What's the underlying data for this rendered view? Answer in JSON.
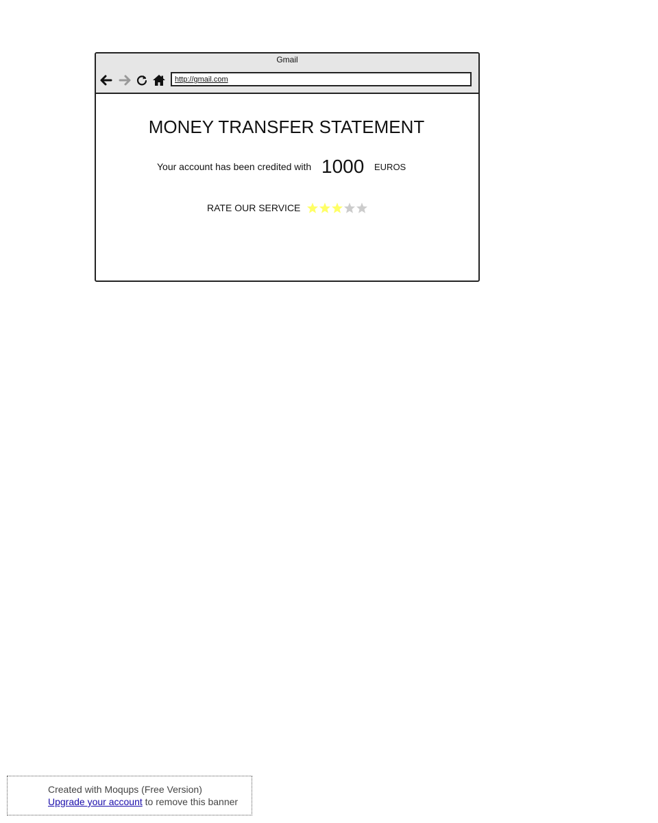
{
  "browser": {
    "window_title": "Gmail",
    "address": "http://gmail.com",
    "nav_icons": [
      "back-arrow-icon",
      "forward-arrow-icon",
      "reload-icon",
      "home-icon"
    ]
  },
  "statement": {
    "title": "MONEY TRANSFER STATEMENT",
    "credit_text": "Your account has been credited with",
    "amount": "1000",
    "currency": "EUROS"
  },
  "rating": {
    "label": "RATE OUR SERVICE",
    "value": 3,
    "max": 5,
    "filled_color": "#ffff66",
    "empty_color": "#cccccc"
  },
  "banner": {
    "line1": "Created with Moqups (Free Version)",
    "link_text": "Upgrade your account",
    "line2_suffix": " to remove this banner"
  }
}
